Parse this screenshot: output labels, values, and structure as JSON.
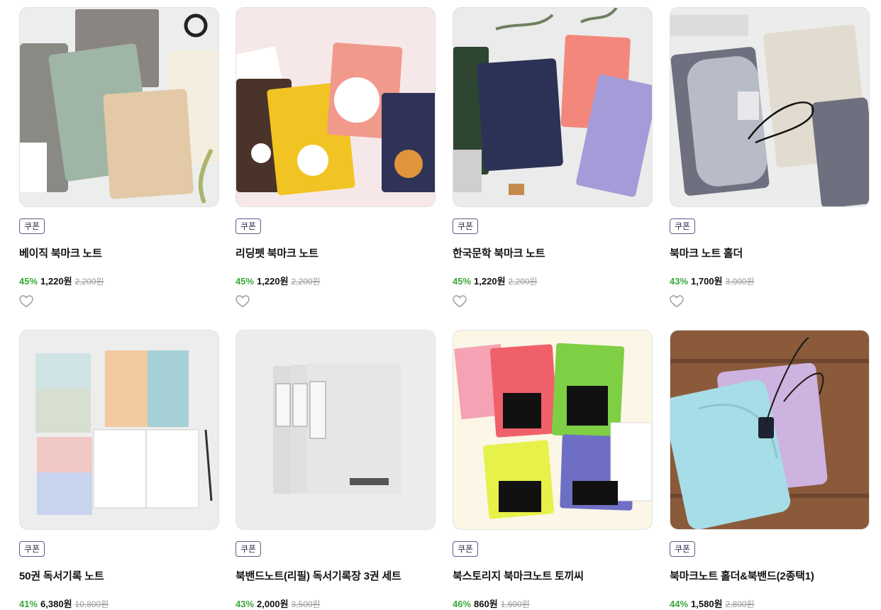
{
  "products": [
    {
      "badge": "쿠폰",
      "title": "베이직 북마크 노트",
      "discount": "45%",
      "price": "1,220원",
      "original": "2,200원",
      "image": "basic-bookmark-notes-photo"
    },
    {
      "badge": "쿠폰",
      "title": "리딩펫 북마크 노트",
      "discount": "45%",
      "price": "1,220원",
      "original": "2,200원",
      "image": "reading-pet-bookmark-notes-photo"
    },
    {
      "badge": "쿠폰",
      "title": "한국문학 북마크 노트",
      "discount": "45%",
      "price": "1,220원",
      "original": "2,200원",
      "image": "korean-literature-bookmark-notes-photo"
    },
    {
      "badge": "쿠폰",
      "title": "북마크 노트 홀더",
      "discount": "43%",
      "price": "1,700원",
      "original": "3,000원",
      "image": "bookmark-note-holder-photo"
    },
    {
      "badge": "쿠폰",
      "title": "50권 독서기록 노트",
      "discount": "41%",
      "price": "6,380원",
      "original": "10,800원",
      "image": "reading-record-notes-photo"
    },
    {
      "badge": "쿠폰",
      "title": "북밴드노트(리필) 독서기록장 3권 세트",
      "discount": "43%",
      "price": "2,000원",
      "original": "3,500원",
      "image": "bookband-refill-notes-photo"
    },
    {
      "badge": "쿠폰",
      "title": "북스토리지 북마크노트 토끼씨",
      "discount": "46%",
      "price": "860원",
      "original": "1,600원",
      "image": "rabbit-bookmark-notes-photo"
    },
    {
      "badge": "쿠폰",
      "title": "북마크노트 홀더&북밴드(2종택1)",
      "discount": "44%",
      "price": "1,580원",
      "original": "2,800원",
      "image": "holder-and-bookband-photo"
    }
  ],
  "colors": {
    "discount": "#3aa83a",
    "badge_border": "#5a5f8a"
  }
}
